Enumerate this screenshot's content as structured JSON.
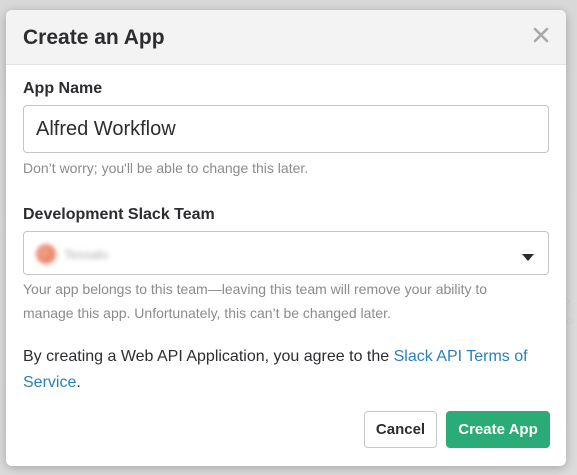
{
  "dialog": {
    "title": "Create an App",
    "close_icon": "close-icon"
  },
  "app_name": {
    "label": "App Name",
    "value": "Alfred Workflow",
    "hint": "Don’t worry; you'll be able to change this later."
  },
  "team": {
    "label": "Development Slack Team",
    "selected": "Tessalo",
    "avatar_color": "#e7785d",
    "hint": "Your app belongs to this team—leaving this team will remove your ability to manage this app. Unfortunately, this can’t be changed later."
  },
  "agreement": {
    "text": "By creating a Web API Application, you agree to the ",
    "link": "Slack API Terms of Service",
    "suffix": "."
  },
  "buttons": {
    "cancel": "Cancel",
    "create": "Create App"
  },
  "colors": {
    "primary": "#2bac76",
    "link": "#2a80b9",
    "header_bg": "#f3f3f3"
  }
}
